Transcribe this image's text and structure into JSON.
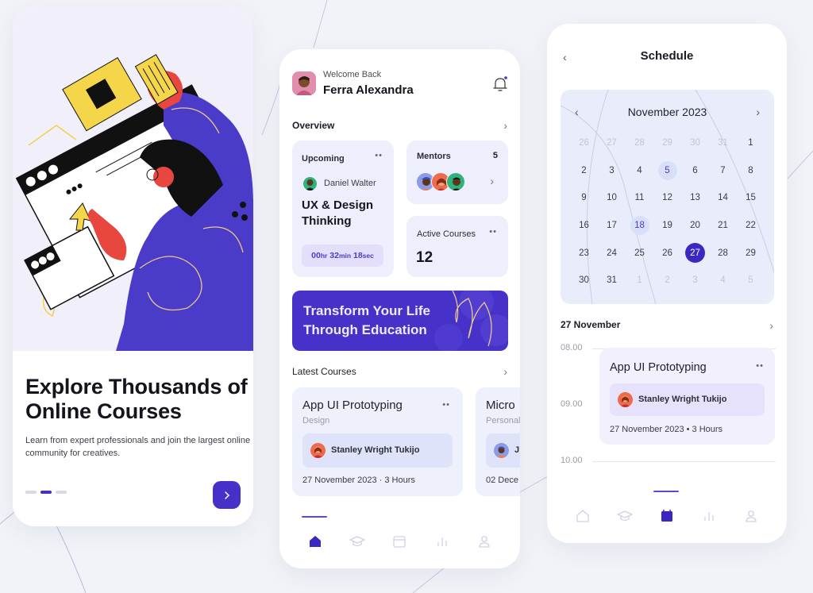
{
  "colors": {
    "brand": "#4530c8",
    "background": "#f1f3f8",
    "card_bg": "#eeeffc",
    "accent_light": "#e3dffb",
    "muted_text": "#9a9aa6"
  },
  "onboarding": {
    "illustration": "person-working-with-browser-windows",
    "title": "Explore Thousands of Online Courses",
    "description": "Learn from expert professionals and join the largest online community for creatives.",
    "pagination": {
      "total": 3,
      "active_index": 1
    },
    "next_icon": "chevron-right-icon"
  },
  "home": {
    "greeting": "Welcome Back",
    "user_name": "Ferra Alexandra",
    "notification_icon": "bell-icon",
    "overview": {
      "title": "Overview",
      "upcoming": {
        "label": "Upcoming",
        "teacher": "Daniel Walter",
        "course": "UX & Design Thinking",
        "timer": {
          "hours": "00",
          "hr_unit": "hr",
          "minutes": "32",
          "min_unit": "min",
          "seconds": "18",
          "sec_unit": "sec"
        }
      },
      "mentors": {
        "label": "Mentors",
        "count": "5"
      },
      "active_courses": {
        "label": "Active Courses",
        "count": "12"
      }
    },
    "banner": {
      "text": "Transform Your Life Through Education"
    },
    "latest_courses": {
      "title": "Latest Courses",
      "items": [
        {
          "title": "App UI Prototyping",
          "category": "Design",
          "teacher": "Stanley Wright Tukijo",
          "meta": "27 November 2023 · 3 Hours"
        },
        {
          "title": "Micro",
          "category": "Personal",
          "teacher": "J",
          "meta": "02 Dece"
        }
      ]
    },
    "tabbar": [
      {
        "name": "home",
        "icon": "home-icon",
        "active": true
      },
      {
        "name": "courses",
        "icon": "graduation-cap-icon",
        "active": false
      },
      {
        "name": "schedule",
        "icon": "calendar-icon",
        "active": false
      },
      {
        "name": "stats",
        "icon": "bar-chart-icon",
        "active": false
      },
      {
        "name": "profile",
        "icon": "user-icon",
        "active": false
      }
    ]
  },
  "schedule": {
    "title": "Schedule",
    "calendar": {
      "month_label": "November 2023",
      "days": [
        {
          "d": "26",
          "m": true
        },
        {
          "d": "27",
          "m": true
        },
        {
          "d": "28",
          "m": true
        },
        {
          "d": "29",
          "m": true
        },
        {
          "d": "30",
          "m": true
        },
        {
          "d": "31",
          "m": true
        },
        {
          "d": "1"
        },
        {
          "d": "2"
        },
        {
          "d": "3"
        },
        {
          "d": "4"
        },
        {
          "d": "5",
          "mark": true
        },
        {
          "d": "6"
        },
        {
          "d": "7"
        },
        {
          "d": "8"
        },
        {
          "d": "9"
        },
        {
          "d": "10"
        },
        {
          "d": "11"
        },
        {
          "d": "12"
        },
        {
          "d": "13"
        },
        {
          "d": "14"
        },
        {
          "d": "15"
        },
        {
          "d": "16"
        },
        {
          "d": "17"
        },
        {
          "d": "18",
          "mark": true
        },
        {
          "d": "19"
        },
        {
          "d": "20"
        },
        {
          "d": "21"
        },
        {
          "d": "22"
        },
        {
          "d": "23"
        },
        {
          "d": "24"
        },
        {
          "d": "25"
        },
        {
          "d": "26"
        },
        {
          "d": "27",
          "sel": true
        },
        {
          "d": "28"
        },
        {
          "d": "29"
        },
        {
          "d": "30"
        },
        {
          "d": "31"
        },
        {
          "d": "1",
          "m": true
        },
        {
          "d": "2",
          "m": true
        },
        {
          "d": "3",
          "m": true
        },
        {
          "d": "4",
          "m": true
        },
        {
          "d": "5",
          "m": true
        }
      ]
    },
    "day_title": "27 November",
    "times": [
      "08.00",
      "09.00",
      "10.00"
    ],
    "event": {
      "title": "App UI Prototyping",
      "teacher": "Stanley Wright Tukijo",
      "meta": "27 November 2023 • 3 Hours"
    },
    "tabbar": [
      {
        "name": "home",
        "icon": "home-icon",
        "active": false
      },
      {
        "name": "courses",
        "icon": "graduation-cap-icon",
        "active": false
      },
      {
        "name": "schedule",
        "icon": "calendar-icon",
        "active": true
      },
      {
        "name": "stats",
        "icon": "bar-chart-icon",
        "active": false
      },
      {
        "name": "profile",
        "icon": "user-icon",
        "active": false
      }
    ]
  }
}
